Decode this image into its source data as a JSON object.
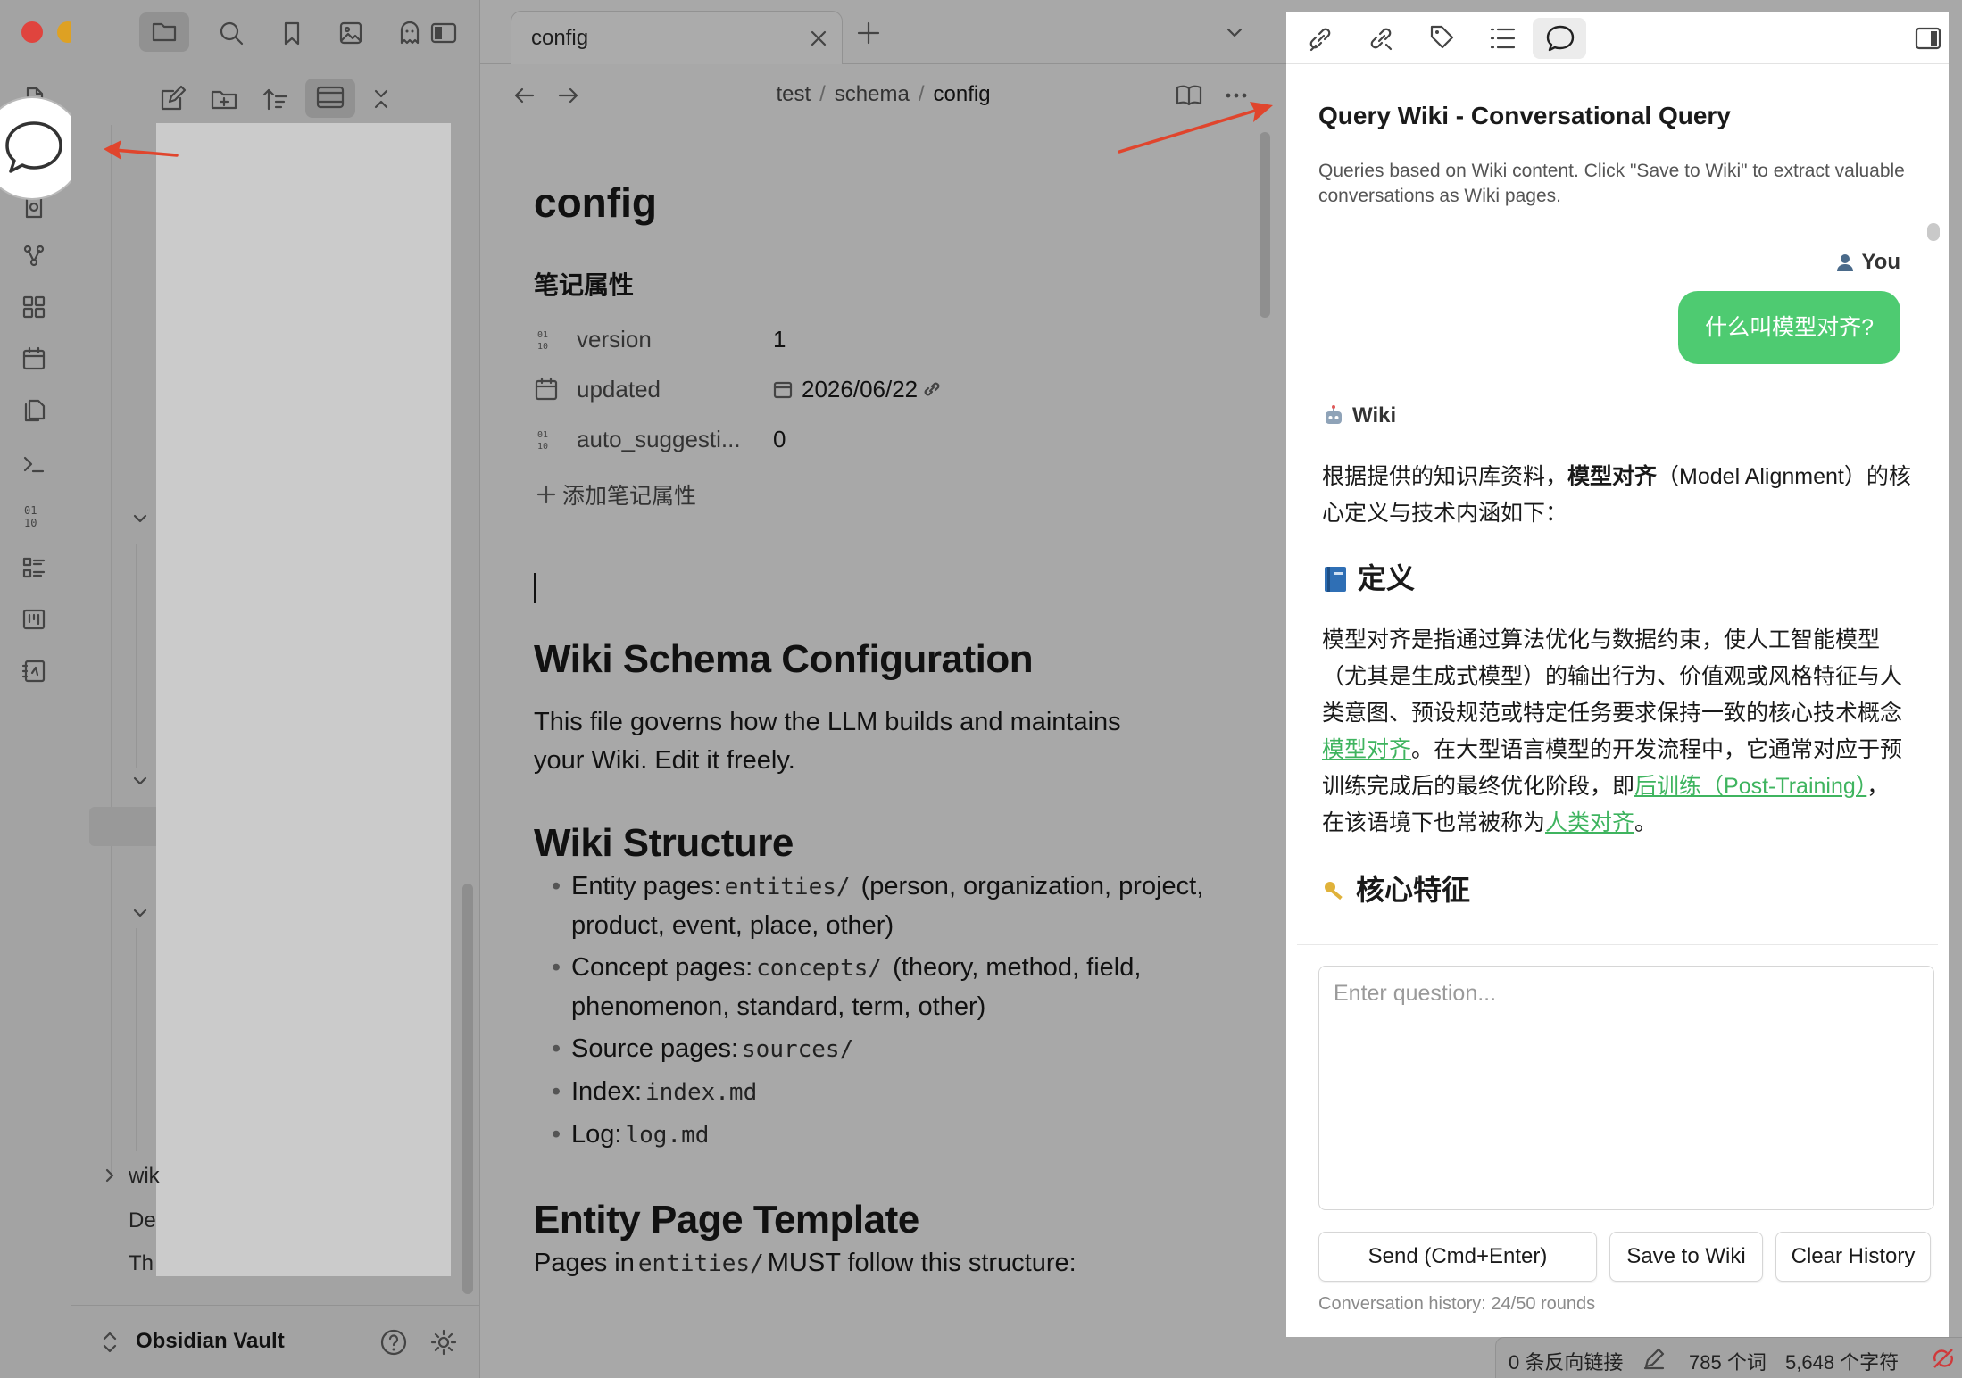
{
  "colors": {
    "accent_green": "#4ecb71",
    "link_green": "#3fb45f",
    "arrow_red": "#e0452d"
  },
  "sidebar": {
    "tree": [
      {
        "label": "wik",
        "expandable": true
      },
      {
        "label": "De",
        "expandable": false
      },
      {
        "label": "Th",
        "expandable": false
      }
    ],
    "vault_name": "Obsidian Vault"
  },
  "editor": {
    "tab_title": "config",
    "breadcrumb": [
      "test",
      "schema",
      "config"
    ],
    "page_title": "config",
    "properties_heading": "笔记属性",
    "properties": [
      {
        "key": "version",
        "value": "1",
        "icon": "number-icon"
      },
      {
        "key": "updated",
        "value": "2026/06/22",
        "icon": "calendar-icon"
      },
      {
        "key": "auto_suggesti...",
        "value": "0",
        "icon": "number-icon"
      }
    ],
    "add_property": "添加笔记属性",
    "h_schema": "Wiki Schema Configuration",
    "intro": "This file governs how the LLM builds and maintains your Wiki. Edit it freely.",
    "h_structure": "Wiki Structure",
    "structure": [
      {
        "label": "Entity pages:",
        "code": "entities/",
        "rest": "(person, organization, project, product, event, place, other)"
      },
      {
        "label": "Concept pages:",
        "code": "concepts/",
        "rest": "(theory, method, field, phenomenon, standard, term, other)"
      },
      {
        "label": "Source pages:",
        "code": "sources/",
        "rest": ""
      },
      {
        "label": "Index:",
        "code": "index.md",
        "rest": ""
      },
      {
        "label": "Log:",
        "code": "log.md",
        "rest": ""
      }
    ],
    "h_entity": "Entity Page Template",
    "entity_text_pre": "Pages in",
    "entity_code": "entities/",
    "entity_text_post": "MUST follow this structure:"
  },
  "panel": {
    "title": "Query Wiki - Conversational Query",
    "description": "Queries based on Wiki content. Click \"Save to Wiki\" to extract valuable conversations as Wiki pages.",
    "you_label": "You",
    "user_message": "什么叫模型对齐?",
    "wiki_label": "Wiki",
    "answer_intro_pre": "根据提供的知识库资料，",
    "answer_intro_strong": "模型对齐",
    "answer_intro_post": "（Model Alignment）的核心定义与技术内涵如下：",
    "definition_heading": "定义",
    "def_text_1": "模型对齐是指通过算法优化与数据约束，使人工智能模型（尤其是生成式模型）的输出行为、价值观或风格特征与人类意图、预设规范或特定任务要求保持一致的核心技术概念",
    "def_link_1": "模型对齐",
    "def_text_2": "。在大型语言模型的开发流程中，它通常对应于预训练完成后的最终优化阶段，即",
    "def_link_2": "后训练（Post-Training）",
    "def_text_3": "，在该语境下也常被称为",
    "def_link_3": "人类对齐",
    "def_text_4": "。",
    "next_heading": "核心特征",
    "input_placeholder": "Enter question...",
    "send_label": "Send (Cmd+Enter)",
    "save_label": "Save to Wiki",
    "clear_label": "Clear History",
    "history": "Conversation history: 24/50 rounds"
  },
  "statusbar": {
    "backlinks": "0 条反向链接",
    "words": "785 个词",
    "chars": "5,648 个字符"
  }
}
